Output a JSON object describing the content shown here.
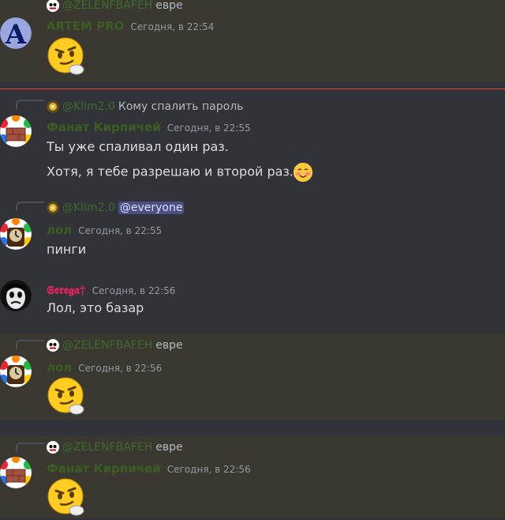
{
  "messages": [
    {
      "reply_name": "@ZELENFBAFEH",
      "reply_text": "евре",
      "username": "ARTEM PRO",
      "timestamp": "Сегодня, в 22:54",
      "avatar_letter": "A",
      "content_type": "emoji",
      "emoji": "thinking-smirk-face"
    },
    {
      "reply_name": "@Klim2.0",
      "reply_text": "Кому спалить пароль",
      "username": "Фанат Кирпичей",
      "timestamp": "Сегодня, в 22:55",
      "lines": [
        "Ты уже спаливал один раз.",
        "Хотя, я тебе разрешаю и второй раз."
      ],
      "inline_emoji": "blushing-smile"
    },
    {
      "reply_name": "@Klim2.0",
      "reply_mention": "@everyone",
      "username": "лол",
      "timestamp": "Сегодня, в 22:55",
      "lines": [
        "пинги"
      ]
    },
    {
      "username": "𝕾𝖊𝖗𝖊𝖌𝖆†",
      "timestamp": "Сегодня, в 22:56",
      "lines": [
        "Лол, это базар"
      ]
    },
    {
      "reply_name": "@ZELENFBAFEH",
      "reply_text": "евре",
      "username": "лол",
      "timestamp": "Сегодня, в 22:56",
      "emoji": "thinking-smirk-face"
    },
    {
      "reply_name": "@ZELENFBAFEH",
      "reply_text": "евре",
      "username": "Фанат Кирпичей",
      "timestamp": "Сегодня, в 22:56",
      "emoji": "thinking-smirk-face"
    }
  ],
  "colors": {
    "background": "#313338",
    "highlight": "#3a3830",
    "new_message_divider": "#f23f42",
    "username_green": "#3a5f22",
    "username_red": "#e0245e",
    "mention_bg": "#4a4f86"
  }
}
